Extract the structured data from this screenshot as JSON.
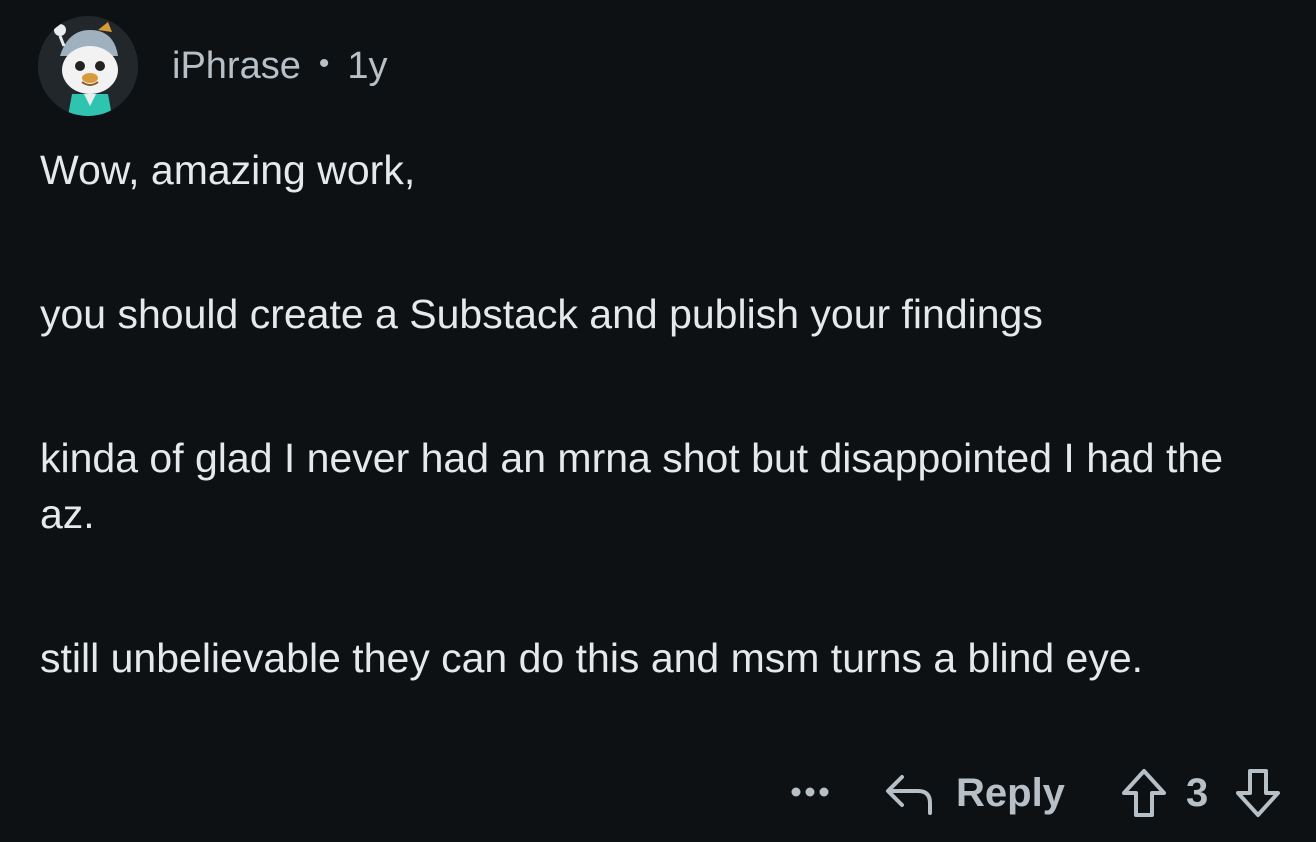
{
  "comment": {
    "author": "iPhrase",
    "separator": "•",
    "age": "1y",
    "paragraphs": [
      "Wow, amazing work,",
      "you should create a Substack and publish your findings",
      "kinda of glad I never had an mrna shot but disappointed I had the az.",
      "still unbelievable they can do this and msm turns a blind eye."
    ]
  },
  "actions": {
    "more_icon": "ellipsis-icon",
    "reply_icon": "reply-arrow-icon",
    "reply_label": "Reply",
    "upvote_icon": "arrow-up-icon",
    "score": "3",
    "downvote_icon": "arrow-down-icon"
  },
  "colors": {
    "background": "#0e1113",
    "text": "#e6e8ea",
    "meta": "#b7c0c7"
  }
}
